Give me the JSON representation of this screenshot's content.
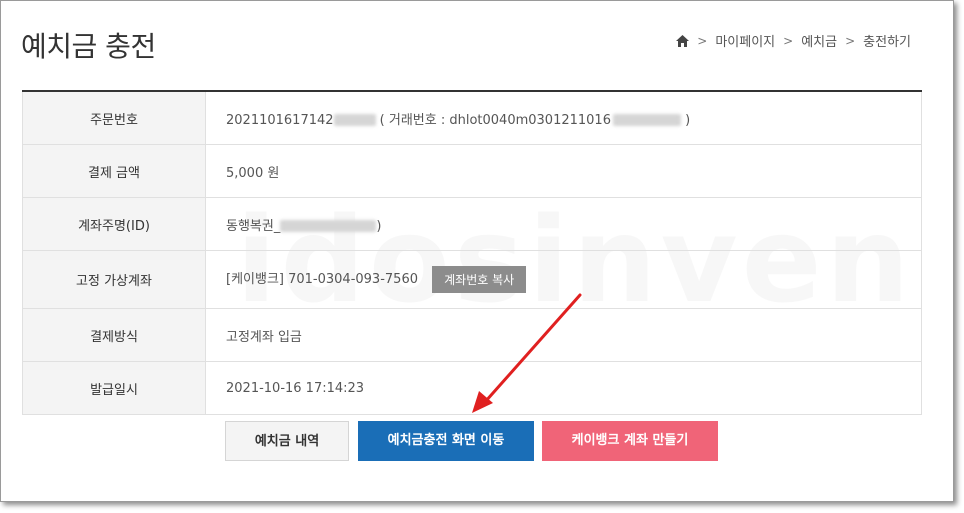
{
  "page": {
    "title": "예치금 충전",
    "breadcrumb": [
      "마이페이지",
      "예치금",
      "충전하기"
    ]
  },
  "rows": [
    {
      "label": "주문번호",
      "value_prefix": "2021101617142",
      "value_mid": " ( 거래번호 : dhlot0040m0301211016",
      "value_suffix": " )"
    },
    {
      "label": "결제 금액",
      "value": "5,000 원"
    },
    {
      "label": "계좌주명(ID)",
      "value_prefix": "동행복권_",
      "value_suffix": ")"
    },
    {
      "label": "고정 가상계좌",
      "value": "[케이뱅크] 701-0304-093-7560",
      "button": "계좌번호 복사"
    },
    {
      "label": "결제방식",
      "value": "고정계좌 입금"
    },
    {
      "label": "발급일시",
      "value": "2021-10-16 17:14:23"
    }
  ],
  "actions": {
    "history": "예치금 내역",
    "charge": "예치금충전 화면 이동",
    "kbank": "케이뱅크 계좌 만들기"
  },
  "watermark": "idosinven",
  "colors": {
    "charge_button": "#1a6eb7",
    "kbank_button": "#f06478",
    "amount_red": "#d03b2c",
    "arrow": "#e02020"
  }
}
